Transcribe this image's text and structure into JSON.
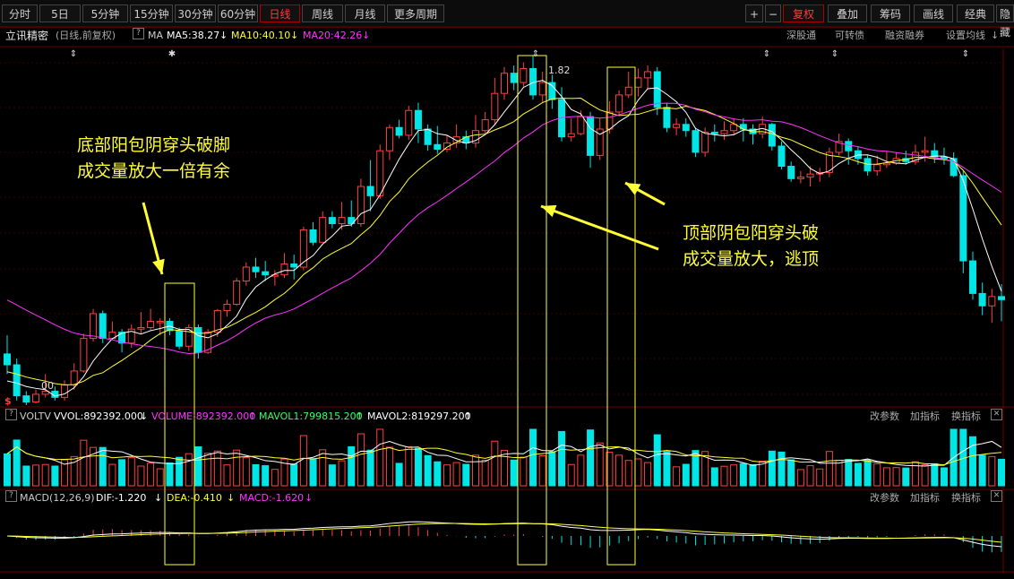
{
  "toolbar": {
    "left_tabs": [
      "分时",
      "5日",
      "5分钟",
      "15分钟",
      "30分钟",
      "60分钟",
      "日线",
      "周线",
      "月线",
      "更多周期"
    ],
    "active_tab": "日线",
    "right_items": [
      "+",
      "−",
      "复权",
      "叠加",
      "筹码",
      "画线",
      "经典",
      "隐藏"
    ]
  },
  "stock_info": {
    "name": "立讯精密",
    "period": "(日线,前复权)",
    "indicator": "MA",
    "ma5": "MA5:38.27",
    "ma10": "MA10:40.10",
    "ma20": "MA20:42.26",
    "right_links": [
      "深股通",
      "可转债",
      "融资融券",
      "设置均线"
    ]
  },
  "price_labels": {
    "high": "1.82",
    "low": "00"
  },
  "volume_bar": {
    "name": "VOLTV",
    "vvol": "VVOL:892392.000",
    "volume": "VOLUME:892392.000",
    "mavol1": "MAVOL1:799815.200",
    "mavol2": "MAVOL2:819297.200",
    "actions": [
      "改参数",
      "加指标",
      "换指标"
    ]
  },
  "macd_bar": {
    "name": "MACD(12,26,9)",
    "dif": "DIF:-1.220",
    "dea": "DEA:-0.410",
    "macd": "MACD:-1.620",
    "actions": [
      "改参数",
      "加指标",
      "换指标"
    ]
  },
  "annotations": {
    "bottom": [
      "底部阳包阴穿头破脚",
      "成交量放大一倍有余"
    ],
    "top": [
      "顶部阴包阳穿头破",
      "成交量放大，逃顶"
    ]
  },
  "colors": {
    "up": "#ff4040",
    "down": "#00e5e5",
    "ma5": "#ffffff",
    "ma10": "#ffff33",
    "ma20": "#ff33ff",
    "annotation": "#ffff33"
  },
  "chart_data": {
    "type": "candlestick",
    "title": "立讯精密",
    "ylim": [
      29.5,
      52.5
    ],
    "candles": [
      [
        32.8,
        32.1,
        34.0,
        31.5
      ],
      [
        32.1,
        30.1,
        32.5,
        29.8
      ],
      [
        30.1,
        29.7,
        30.4,
        29.5
      ],
      [
        29.7,
        30.2,
        30.5,
        29.6
      ],
      [
        30.2,
        30.4,
        31.5,
        30.0
      ],
      [
        30.4,
        30.0,
        30.7,
        29.8
      ],
      [
        30.0,
        30.8,
        31.1,
        29.8
      ],
      [
        30.8,
        31.7,
        32.2,
        30.5
      ],
      [
        31.7,
        33.8,
        34.1,
        31.6
      ],
      [
        33.8,
        35.4,
        35.7,
        33.6
      ],
      [
        35.4,
        33.8,
        35.6,
        33.5
      ],
      [
        33.8,
        34.2,
        34.9,
        33.7
      ],
      [
        34.2,
        33.5,
        34.4,
        32.9
      ],
      [
        33.5,
        34.4,
        34.7,
        33.2
      ],
      [
        34.4,
        34.5,
        35.5,
        34.1
      ],
      [
        34.5,
        34.9,
        35.7,
        34.3
      ],
      [
        34.9,
        34.9,
        35.1,
        34.0
      ],
      [
        34.9,
        34.3,
        35.1,
        34.0
      ],
      [
        34.3,
        33.3,
        34.5,
        33.1
      ],
      [
        33.3,
        34.5,
        34.7,
        33.0
      ],
      [
        34.5,
        32.9,
        34.7,
        32.5
      ],
      [
        32.9,
        34.2,
        34.4,
        32.8
      ],
      [
        34.2,
        35.6,
        35.7,
        33.9
      ],
      [
        35.6,
        36.0,
        36.3,
        35.2
      ],
      [
        36.0,
        37.5,
        37.7,
        35.9
      ],
      [
        37.5,
        38.4,
        38.7,
        37.2
      ],
      [
        38.4,
        38.1,
        39.0,
        37.7
      ],
      [
        38.1,
        37.9,
        38.8,
        37.5
      ],
      [
        37.9,
        37.9,
        38.2,
        37.2
      ],
      [
        37.9,
        38.6,
        39.3,
        37.7
      ],
      [
        38.6,
        38.4,
        39.2,
        37.6
      ],
      [
        38.4,
        40.8,
        41.0,
        38.2
      ],
      [
        40.8,
        40.0,
        41.3,
        39.8
      ],
      [
        40.0,
        41.6,
        42.0,
        40.3
      ],
      [
        41.6,
        41.2,
        42.0,
        40.9
      ],
      [
        41.2,
        41.6,
        42.6,
        40.8
      ],
      [
        41.6,
        41.2,
        42.7,
        41.0
      ],
      [
        41.2,
        43.6,
        44.1,
        41.0
      ],
      [
        43.6,
        43.0,
        45.3,
        42.0
      ],
      [
        43.0,
        45.9,
        46.3,
        42.8
      ],
      [
        45.9,
        47.4,
        47.6,
        45.3
      ],
      [
        47.4,
        46.9,
        47.9,
        46.7
      ],
      [
        46.9,
        48.5,
        48.8,
        46.6
      ],
      [
        48.5,
        47.3,
        49.0,
        46.4
      ],
      [
        47.3,
        46.3,
        47.6,
        45.9
      ],
      [
        46.3,
        46.0,
        47.5,
        45.7
      ],
      [
        46.0,
        46.4,
        46.9,
        45.8
      ],
      [
        46.4,
        46.8,
        47.6,
        46.1
      ],
      [
        46.8,
        46.4,
        47.2,
        46.0
      ],
      [
        46.4,
        47.2,
        48.2,
        46.1
      ],
      [
        47.2,
        47.9,
        48.4,
        47.0
      ],
      [
        47.9,
        49.6,
        50.6,
        47.6
      ],
      [
        49.6,
        50.9,
        51.3,
        49.2
      ],
      [
        50.9,
        50.3,
        51.4,
        49.8
      ],
      [
        50.3,
        51.2,
        51.6,
        50.0
      ],
      [
        51.2,
        49.5,
        52.0,
        49.2
      ],
      [
        49.5,
        50.3,
        51.0,
        49.0
      ],
      [
        50.3,
        49.2,
        50.8,
        48.6
      ],
      [
        49.2,
        46.8,
        50.0,
        46.5
      ],
      [
        46.8,
        47.0,
        48.0,
        46.5
      ],
      [
        47.0,
        48.1,
        48.5,
        46.9
      ],
      [
        48.1,
        45.6,
        48.4,
        44.8
      ],
      [
        45.6,
        47.3,
        48.0,
        45.3
      ],
      [
        47.3,
        48.4,
        49.1,
        47.0
      ],
      [
        48.4,
        49.5,
        49.8,
        48.2
      ],
      [
        49.5,
        50.0,
        51.0,
        49.3
      ],
      [
        50.0,
        50.6,
        51.2,
        49.4
      ],
      [
        50.6,
        51.0,
        51.4,
        49.9
      ],
      [
        51.0,
        48.7,
        51.3,
        48.2
      ],
      [
        48.7,
        47.4,
        49.0,
        47.1
      ],
      [
        47.4,
        47.6,
        48.0,
        46.9
      ],
      [
        47.6,
        47.2,
        48.0,
        46.8
      ],
      [
        47.2,
        45.8,
        47.4,
        45.5
      ],
      [
        45.8,
        47.1,
        47.4,
        45.5
      ],
      [
        47.1,
        47.0,
        47.6,
        46.5
      ],
      [
        47.0,
        47.2,
        47.8,
        46.6
      ],
      [
        47.2,
        47.6,
        48.0,
        46.9
      ],
      [
        47.6,
        47.3,
        48.0,
        46.5
      ],
      [
        47.3,
        47.0,
        47.6,
        46.3
      ],
      [
        47.0,
        47.6,
        48.1,
        46.7
      ],
      [
        47.6,
        46.2,
        47.7,
        45.9
      ],
      [
        46.2,
        44.9,
        46.5,
        44.7
      ],
      [
        44.9,
        44.1,
        45.2,
        43.9
      ],
      [
        44.1,
        44.2,
        44.6,
        43.8
      ],
      [
        44.2,
        44.4,
        44.9,
        43.6
      ],
      [
        44.4,
        44.5,
        44.8,
        43.9
      ],
      [
        44.5,
        45.8,
        46.1,
        44.2
      ],
      [
        45.8,
        46.5,
        47.0,
        45.6
      ],
      [
        46.5,
        45.9,
        46.7,
        45.0
      ],
      [
        45.9,
        45.4,
        46.2,
        45.0
      ],
      [
        45.4,
        44.6,
        45.6,
        44.3
      ],
      [
        44.6,
        45.0,
        45.6,
        44.3
      ],
      [
        45.0,
        45.1,
        45.9,
        44.8
      ],
      [
        45.1,
        45.4,
        45.8,
        45.0
      ],
      [
        45.4,
        45.2,
        45.9,
        45.0
      ],
      [
        45.2,
        45.8,
        46.3,
        45.0
      ],
      [
        45.8,
        45.9,
        46.8,
        45.2
      ],
      [
        45.9,
        45.5,
        46.4,
        45.1
      ],
      [
        45.5,
        45.4,
        46.1,
        45.0
      ],
      [
        45.4,
        44.3,
        45.8,
        44.2
      ],
      [
        44.3,
        38.8,
        44.6,
        38.0
      ],
      [
        38.8,
        36.7,
        39.4,
        36.3
      ],
      [
        36.7,
        35.9,
        37.4,
        35.3
      ],
      [
        35.9,
        36.5,
        37.0,
        34.8
      ],
      [
        36.5,
        36.3,
        37.3,
        34.9
      ]
    ]
  }
}
